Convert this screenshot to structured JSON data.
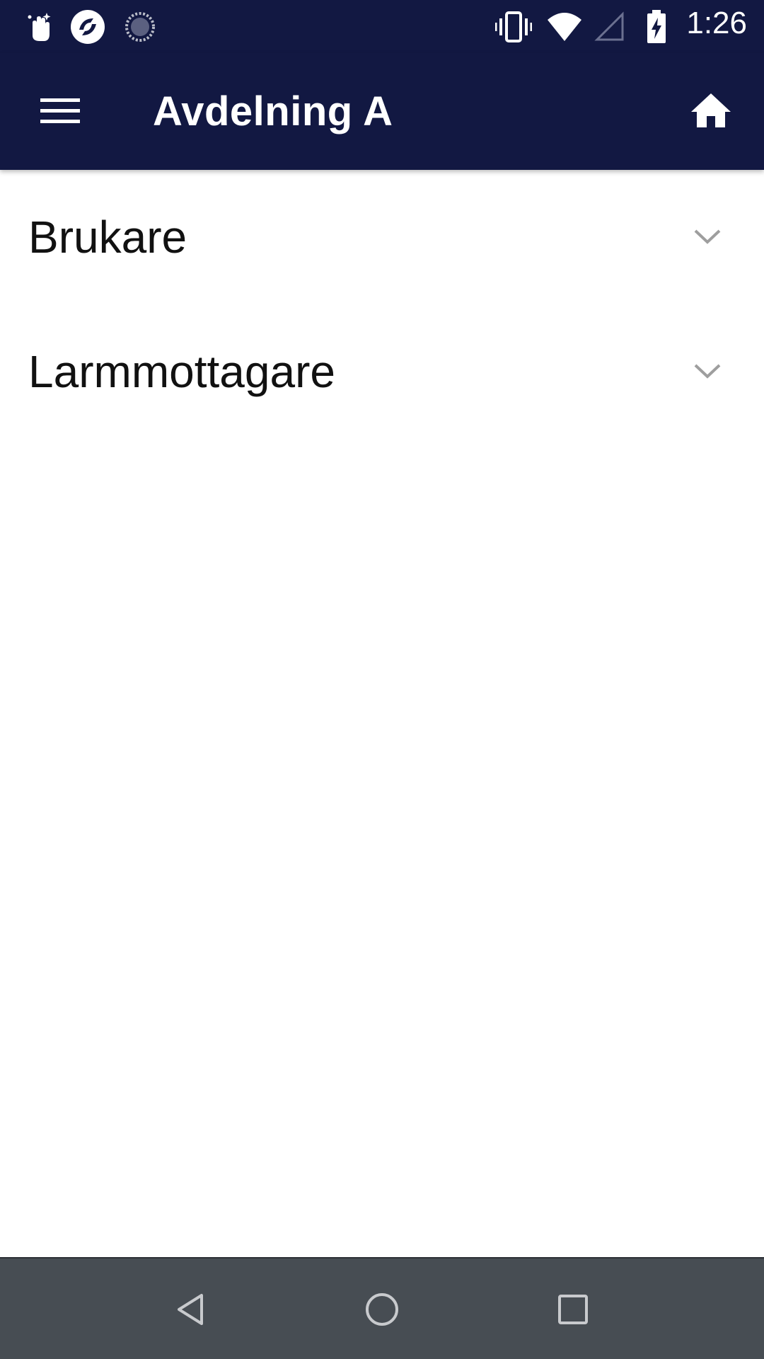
{
  "status_bar": {
    "time": "1:26",
    "left_icons": [
      "gesture-hand-icon",
      "app-logo-icon",
      "loading-spinner-icon"
    ],
    "right_icons": [
      "vibrate-icon",
      "wifi-icon",
      "cellular-signal-icon",
      "battery-charging-icon"
    ]
  },
  "app_bar": {
    "title": "Avdelning A",
    "menu_icon": "hamburger-menu-icon",
    "home_icon": "home-icon"
  },
  "sections": [
    {
      "label": "Brukare",
      "expanded": false
    },
    {
      "label": "Larmmottagare",
      "expanded": false
    }
  ],
  "navigation_bar": {
    "buttons": [
      "back-icon",
      "home-circle-icon",
      "recents-icon"
    ]
  },
  "colors": {
    "primary": "#121842",
    "nav_bar": "#474d53",
    "chevron": "#9e9e9e",
    "text": "#111111"
  }
}
